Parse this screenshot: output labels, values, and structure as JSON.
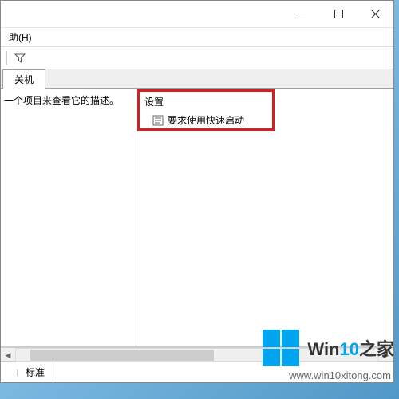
{
  "menu": {
    "help": "助(H)"
  },
  "tabs": {
    "shutdown": "关机"
  },
  "left_pane": {
    "hint_text": "一个项目来查看它的描述。"
  },
  "right_pane": {
    "section_label": "设置",
    "item_label": "要求使用快速启动"
  },
  "bottom_tabs": {
    "tab1": "",
    "tab2": "标准"
  },
  "watermark": {
    "brand_prefix": "Win",
    "brand_accent": "10",
    "brand_suffix": "之家",
    "url": "www.win10xitong.com"
  },
  "icons": {
    "minimize": "minimize-icon",
    "maximize": "maximize-icon",
    "close": "close-icon",
    "filter": "filter-icon",
    "policy": "policy-icon"
  }
}
